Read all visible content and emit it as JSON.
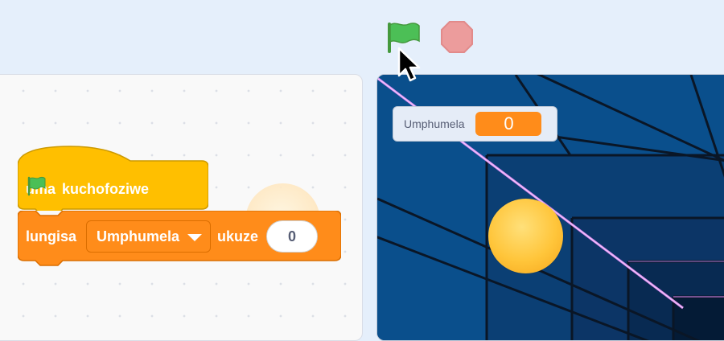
{
  "toolbar": {
    "green_flag_icon": "green-flag-icon",
    "stop_icon": "stop-icon"
  },
  "code": {
    "hat_block": {
      "prefix": "uma",
      "flag_icon": "green-flag-icon",
      "suffix": "kuchofoziwe"
    },
    "set_block": {
      "verb": "lungisa",
      "variable": "Umphumela",
      "word_to": "ukuze",
      "value": "0"
    }
  },
  "stage": {
    "monitor": {
      "label": "Umphumela",
      "value": "0"
    }
  },
  "colors": {
    "events": "#ffbf00",
    "variables": "#ff8c1a",
    "stage_bg": "#0a4f8c"
  }
}
